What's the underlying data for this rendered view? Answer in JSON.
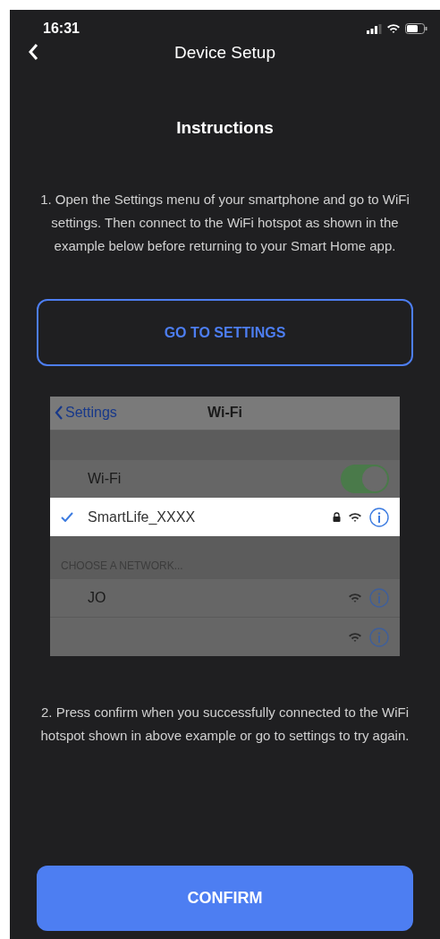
{
  "status_bar": {
    "time": "16:31"
  },
  "nav": {
    "title": "Device Setup"
  },
  "heading": "Instructions",
  "step_1": "1. Open the Settings menu of your smartphone and go to WiFi settings. Then connect to the WiFi hotspot as shown in the example below before returning to your Smart Home app.",
  "settings_button": "GO TO SETTINGS",
  "example": {
    "back_label": "Settings",
    "title": "Wi-Fi",
    "wifi_toggle": {
      "label": "Wi-Fi",
      "on": true
    },
    "connected": [
      {
        "name": "SmartLife_XXXX",
        "selected": true,
        "locked": true
      }
    ],
    "section_header": "CHOOSE A NETWORK...",
    "networks": [
      {
        "name": "JO",
        "selected": false,
        "locked": false
      }
    ]
  },
  "step_2": "2. Press confirm when you successfully connected to the WiFi hotspot shown in above example or go to settings to try again.",
  "confirm_button": "CONFIRM"
}
